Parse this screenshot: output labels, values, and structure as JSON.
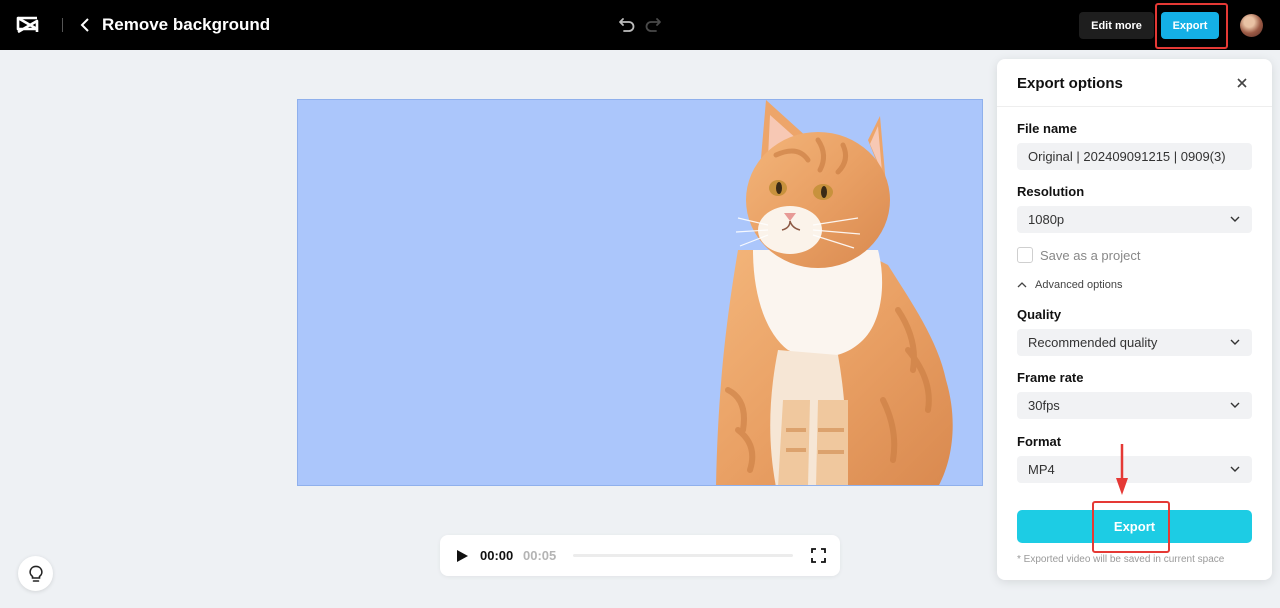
{
  "app": {
    "title": "Remove background"
  },
  "toolbar": {
    "edit_more_label": "Edit more",
    "export_label": "Export"
  },
  "player": {
    "current_time": "00:00",
    "total_time": "00:05",
    "progress": 0
  },
  "export_panel": {
    "title": "Export options",
    "file_name_label": "File name",
    "file_name_value": "Original | 202409091215 | 0909(3)",
    "resolution_label": "Resolution",
    "resolution_value": "1080p",
    "save_project_label": "Save as a project",
    "save_project_checked": false,
    "advanced_label": "Advanced options",
    "quality_label": "Quality",
    "quality_value": "Recommended quality",
    "frame_rate_label": "Frame rate",
    "frame_rate_value": "30fps",
    "format_label": "Format",
    "format_value": "MP4",
    "export_button_label": "Export",
    "note": "* Exported video will be saved in current space"
  },
  "colors": {
    "topbar_bg": "#000000",
    "accent": "#14b0e6",
    "export_button": "#1dcce4",
    "canvas_bg": "#abc6fb",
    "highlight": "#e53935"
  },
  "icons": [
    "capcut-logo-icon",
    "chevron-left-icon",
    "undo-icon",
    "redo-icon",
    "avatar",
    "play-icon",
    "fullscreen-icon",
    "lightbulb-icon",
    "close-icon",
    "chevron-down-icon",
    "chevron-up-icon"
  ]
}
